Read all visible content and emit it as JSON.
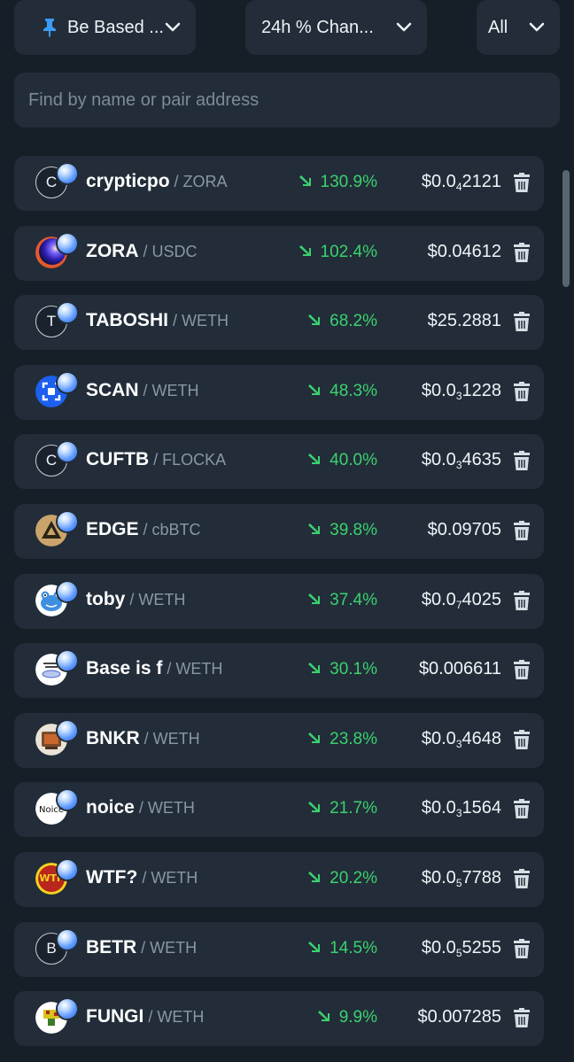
{
  "filters": {
    "pinned_label": "Be Based ...",
    "sort_label": "24h % Chan...",
    "scope_label": "All"
  },
  "search": {
    "placeholder": "Find by name or pair address"
  },
  "colors": {
    "background": "#161f28",
    "card": "#222d39",
    "positive": "#3bd16f",
    "pin": "#3b9cf5"
  },
  "tokens": [
    {
      "name": "crypticpo",
      "pair": "ZORA",
      "change": "130.9%",
      "price_prefix": "$0.0",
      "price_sub": "4",
      "price_suffix": "2121",
      "avatar_letter": "C",
      "avatar_icon": "letter-avatar-icon"
    },
    {
      "name": "ZORA",
      "pair": "USDC",
      "change": "102.4%",
      "price_prefix": "$0.04612",
      "price_sub": "",
      "price_suffix": "",
      "avatar_letter": "",
      "avatar_icon": "zora-orb-icon"
    },
    {
      "name": "TABOSHI",
      "pair": "WETH",
      "change": "68.2%",
      "price_prefix": "$25.2881",
      "price_sub": "",
      "price_suffix": "",
      "avatar_letter": "T",
      "avatar_icon": "letter-avatar-icon"
    },
    {
      "name": "SCAN",
      "pair": "WETH",
      "change": "48.3%",
      "price_prefix": "$0.0",
      "price_sub": "3",
      "price_suffix": "1228",
      "avatar_letter": "",
      "avatar_icon": "scan-logo-icon"
    },
    {
      "name": "CUFTB",
      "pair": "FLOCKA",
      "change": "40.0%",
      "price_prefix": "$0.0",
      "price_sub": "3",
      "price_suffix": "4635",
      "avatar_letter": "C",
      "avatar_icon": "letter-avatar-icon"
    },
    {
      "name": "EDGE",
      "pair": "cbBTC",
      "change": "39.8%",
      "price_prefix": "$0.09705",
      "price_sub": "",
      "price_suffix": "",
      "avatar_letter": "",
      "avatar_icon": "edge-triangle-icon"
    },
    {
      "name": "toby",
      "pair": "WETH",
      "change": "37.4%",
      "price_prefix": "$0.0",
      "price_sub": "7",
      "price_suffix": "4025",
      "avatar_letter": "",
      "avatar_icon": "toby-toad-icon"
    },
    {
      "name": "Base is f",
      "pair": "WETH",
      "change": "30.1%",
      "price_prefix": "$0.006611",
      "price_sub": "",
      "price_suffix": "",
      "avatar_letter": "",
      "avatar_icon": "base-is-for-icon"
    },
    {
      "name": "BNKR",
      "pair": "WETH",
      "change": "23.8%",
      "price_prefix": "$0.0",
      "price_sub": "3",
      "price_suffix": "4648",
      "avatar_letter": "",
      "avatar_icon": "bnkr-computer-icon"
    },
    {
      "name": "noice",
      "pair": "WETH",
      "change": "21.7%",
      "price_prefix": "$0.0",
      "price_sub": "3",
      "price_suffix": "1564",
      "avatar_letter": "",
      "avatar_icon": "noice-text-icon"
    },
    {
      "name": "WTF?",
      "pair": "WETH",
      "change": "20.2%",
      "price_prefix": "$0.0",
      "price_sub": "5",
      "price_suffix": "7788",
      "avatar_letter": "",
      "avatar_icon": "wtf-badge-icon"
    },
    {
      "name": "BETR",
      "pair": "WETH",
      "change": "14.5%",
      "price_prefix": "$0.0",
      "price_sub": "5",
      "price_suffix": "5255",
      "avatar_letter": "B",
      "avatar_icon": "letter-avatar-icon"
    },
    {
      "name": "FUNGI",
      "pair": "WETH",
      "change": "9.9%",
      "price_prefix": "$0.007285",
      "price_sub": "",
      "price_suffix": "",
      "avatar_letter": "",
      "avatar_icon": "fungi-pixel-icon"
    }
  ]
}
